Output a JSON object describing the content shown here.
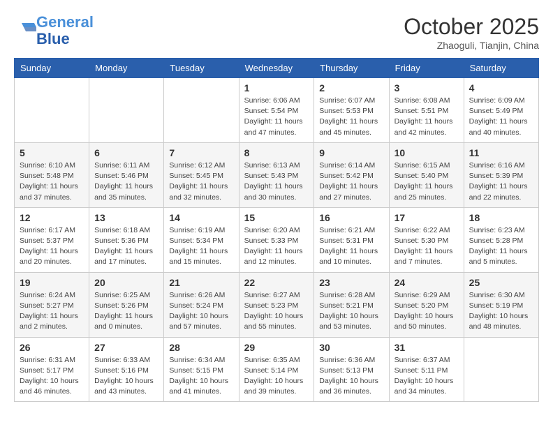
{
  "header": {
    "logo_line1": "General",
    "logo_line2": "Blue",
    "title": "October 2025",
    "subtitle": "Zhaoguli, Tianjin, China"
  },
  "weekdays": [
    "Sunday",
    "Monday",
    "Tuesday",
    "Wednesday",
    "Thursday",
    "Friday",
    "Saturday"
  ],
  "weeks": [
    [
      {
        "day": "",
        "info": ""
      },
      {
        "day": "",
        "info": ""
      },
      {
        "day": "",
        "info": ""
      },
      {
        "day": "1",
        "info": "Sunrise: 6:06 AM\nSunset: 5:54 PM\nDaylight: 11 hours\nand 47 minutes."
      },
      {
        "day": "2",
        "info": "Sunrise: 6:07 AM\nSunset: 5:53 PM\nDaylight: 11 hours\nand 45 minutes."
      },
      {
        "day": "3",
        "info": "Sunrise: 6:08 AM\nSunset: 5:51 PM\nDaylight: 11 hours\nand 42 minutes."
      },
      {
        "day": "4",
        "info": "Sunrise: 6:09 AM\nSunset: 5:49 PM\nDaylight: 11 hours\nand 40 minutes."
      }
    ],
    [
      {
        "day": "5",
        "info": "Sunrise: 6:10 AM\nSunset: 5:48 PM\nDaylight: 11 hours\nand 37 minutes."
      },
      {
        "day": "6",
        "info": "Sunrise: 6:11 AM\nSunset: 5:46 PM\nDaylight: 11 hours\nand 35 minutes."
      },
      {
        "day": "7",
        "info": "Sunrise: 6:12 AM\nSunset: 5:45 PM\nDaylight: 11 hours\nand 32 minutes."
      },
      {
        "day": "8",
        "info": "Sunrise: 6:13 AM\nSunset: 5:43 PM\nDaylight: 11 hours\nand 30 minutes."
      },
      {
        "day": "9",
        "info": "Sunrise: 6:14 AM\nSunset: 5:42 PM\nDaylight: 11 hours\nand 27 minutes."
      },
      {
        "day": "10",
        "info": "Sunrise: 6:15 AM\nSunset: 5:40 PM\nDaylight: 11 hours\nand 25 minutes."
      },
      {
        "day": "11",
        "info": "Sunrise: 6:16 AM\nSunset: 5:39 PM\nDaylight: 11 hours\nand 22 minutes."
      }
    ],
    [
      {
        "day": "12",
        "info": "Sunrise: 6:17 AM\nSunset: 5:37 PM\nDaylight: 11 hours\nand 20 minutes."
      },
      {
        "day": "13",
        "info": "Sunrise: 6:18 AM\nSunset: 5:36 PM\nDaylight: 11 hours\nand 17 minutes."
      },
      {
        "day": "14",
        "info": "Sunrise: 6:19 AM\nSunset: 5:34 PM\nDaylight: 11 hours\nand 15 minutes."
      },
      {
        "day": "15",
        "info": "Sunrise: 6:20 AM\nSunset: 5:33 PM\nDaylight: 11 hours\nand 12 minutes."
      },
      {
        "day": "16",
        "info": "Sunrise: 6:21 AM\nSunset: 5:31 PM\nDaylight: 11 hours\nand 10 minutes."
      },
      {
        "day": "17",
        "info": "Sunrise: 6:22 AM\nSunset: 5:30 PM\nDaylight: 11 hours\nand 7 minutes."
      },
      {
        "day": "18",
        "info": "Sunrise: 6:23 AM\nSunset: 5:28 PM\nDaylight: 11 hours\nand 5 minutes."
      }
    ],
    [
      {
        "day": "19",
        "info": "Sunrise: 6:24 AM\nSunset: 5:27 PM\nDaylight: 11 hours\nand 2 minutes."
      },
      {
        "day": "20",
        "info": "Sunrise: 6:25 AM\nSunset: 5:26 PM\nDaylight: 11 hours\nand 0 minutes."
      },
      {
        "day": "21",
        "info": "Sunrise: 6:26 AM\nSunset: 5:24 PM\nDaylight: 10 hours\nand 57 minutes."
      },
      {
        "day": "22",
        "info": "Sunrise: 6:27 AM\nSunset: 5:23 PM\nDaylight: 10 hours\nand 55 minutes."
      },
      {
        "day": "23",
        "info": "Sunrise: 6:28 AM\nSunset: 5:21 PM\nDaylight: 10 hours\nand 53 minutes."
      },
      {
        "day": "24",
        "info": "Sunrise: 6:29 AM\nSunset: 5:20 PM\nDaylight: 10 hours\nand 50 minutes."
      },
      {
        "day": "25",
        "info": "Sunrise: 6:30 AM\nSunset: 5:19 PM\nDaylight: 10 hours\nand 48 minutes."
      }
    ],
    [
      {
        "day": "26",
        "info": "Sunrise: 6:31 AM\nSunset: 5:17 PM\nDaylight: 10 hours\nand 46 minutes."
      },
      {
        "day": "27",
        "info": "Sunrise: 6:33 AM\nSunset: 5:16 PM\nDaylight: 10 hours\nand 43 minutes."
      },
      {
        "day": "28",
        "info": "Sunrise: 6:34 AM\nSunset: 5:15 PM\nDaylight: 10 hours\nand 41 minutes."
      },
      {
        "day": "29",
        "info": "Sunrise: 6:35 AM\nSunset: 5:14 PM\nDaylight: 10 hours\nand 39 minutes."
      },
      {
        "day": "30",
        "info": "Sunrise: 6:36 AM\nSunset: 5:13 PM\nDaylight: 10 hours\nand 36 minutes."
      },
      {
        "day": "31",
        "info": "Sunrise: 6:37 AM\nSunset: 5:11 PM\nDaylight: 10 hours\nand 34 minutes."
      },
      {
        "day": "",
        "info": ""
      }
    ]
  ]
}
